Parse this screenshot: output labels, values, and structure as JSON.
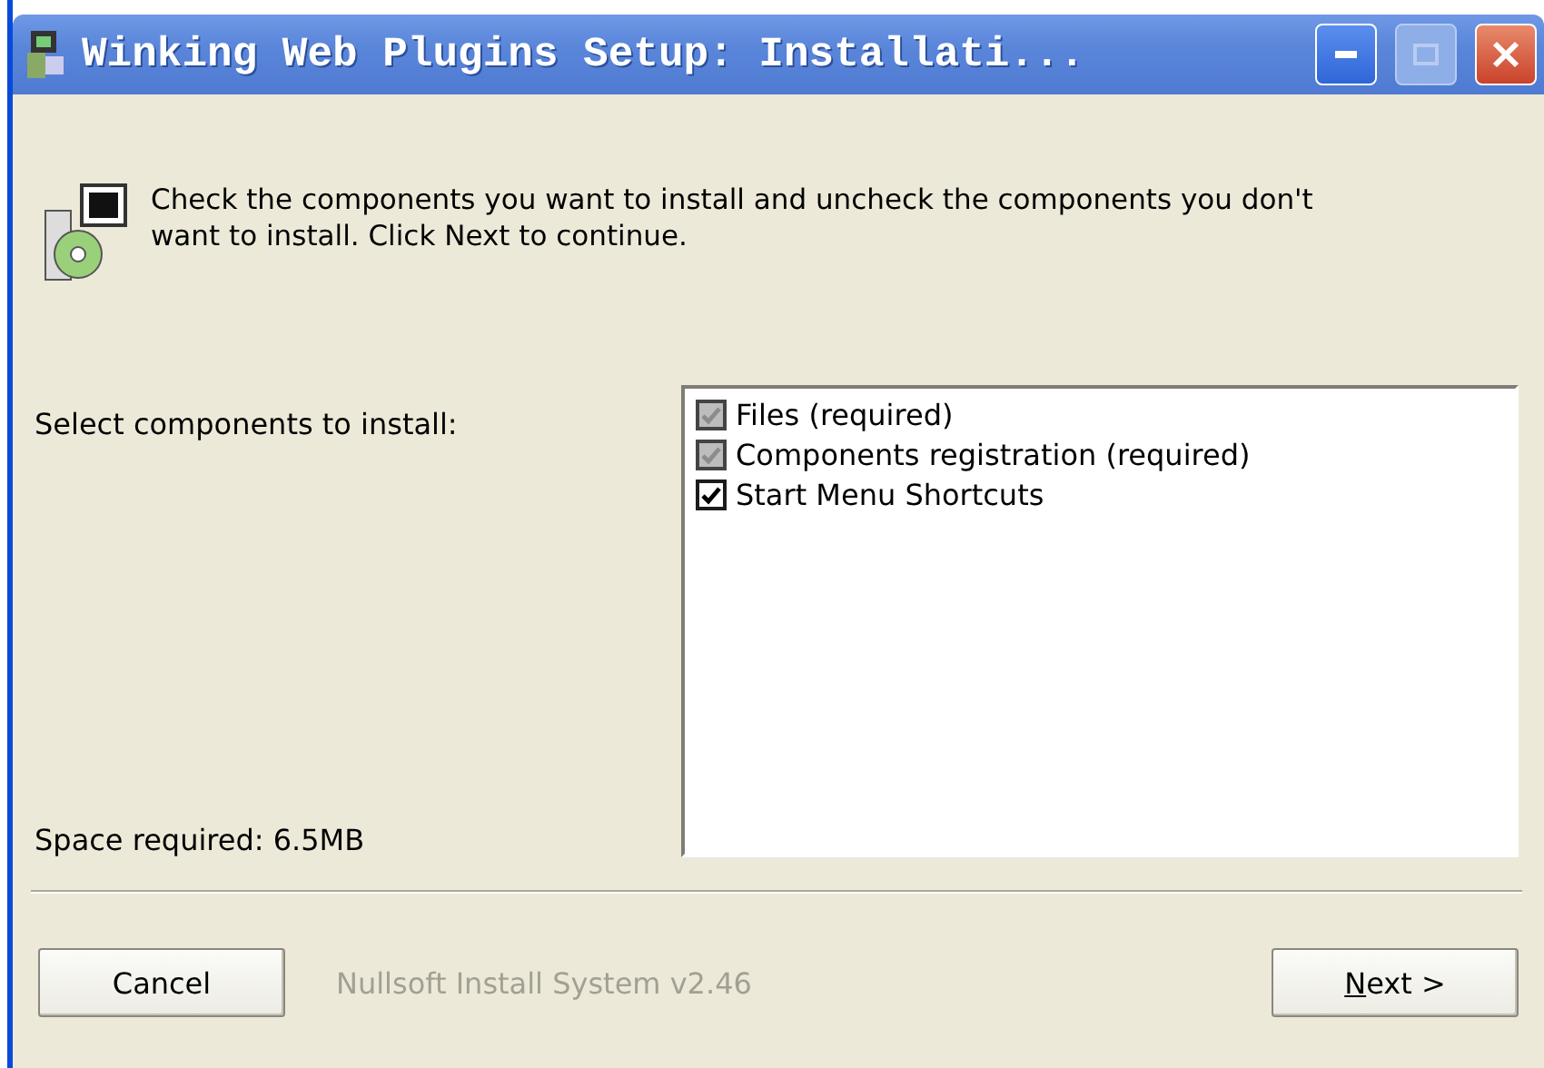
{
  "window": {
    "title": "Winking Web Plugins Setup: Installati..."
  },
  "header": {
    "text": "Check the components you want to install and uncheck the components you don't want to install. Click Next to continue."
  },
  "select_label": "Select components to install:",
  "components": [
    {
      "label": "Files (required)",
      "checked": true,
      "disabled": true
    },
    {
      "label": "Components registration (required)",
      "checked": true,
      "disabled": true
    },
    {
      "label": "Start Menu Shortcuts",
      "checked": true,
      "disabled": false
    }
  ],
  "space_required": "Space required: 6.5MB",
  "branding": "Nullsoft Install System v2.46",
  "buttons": {
    "cancel": "Cancel",
    "next": "Next >"
  }
}
